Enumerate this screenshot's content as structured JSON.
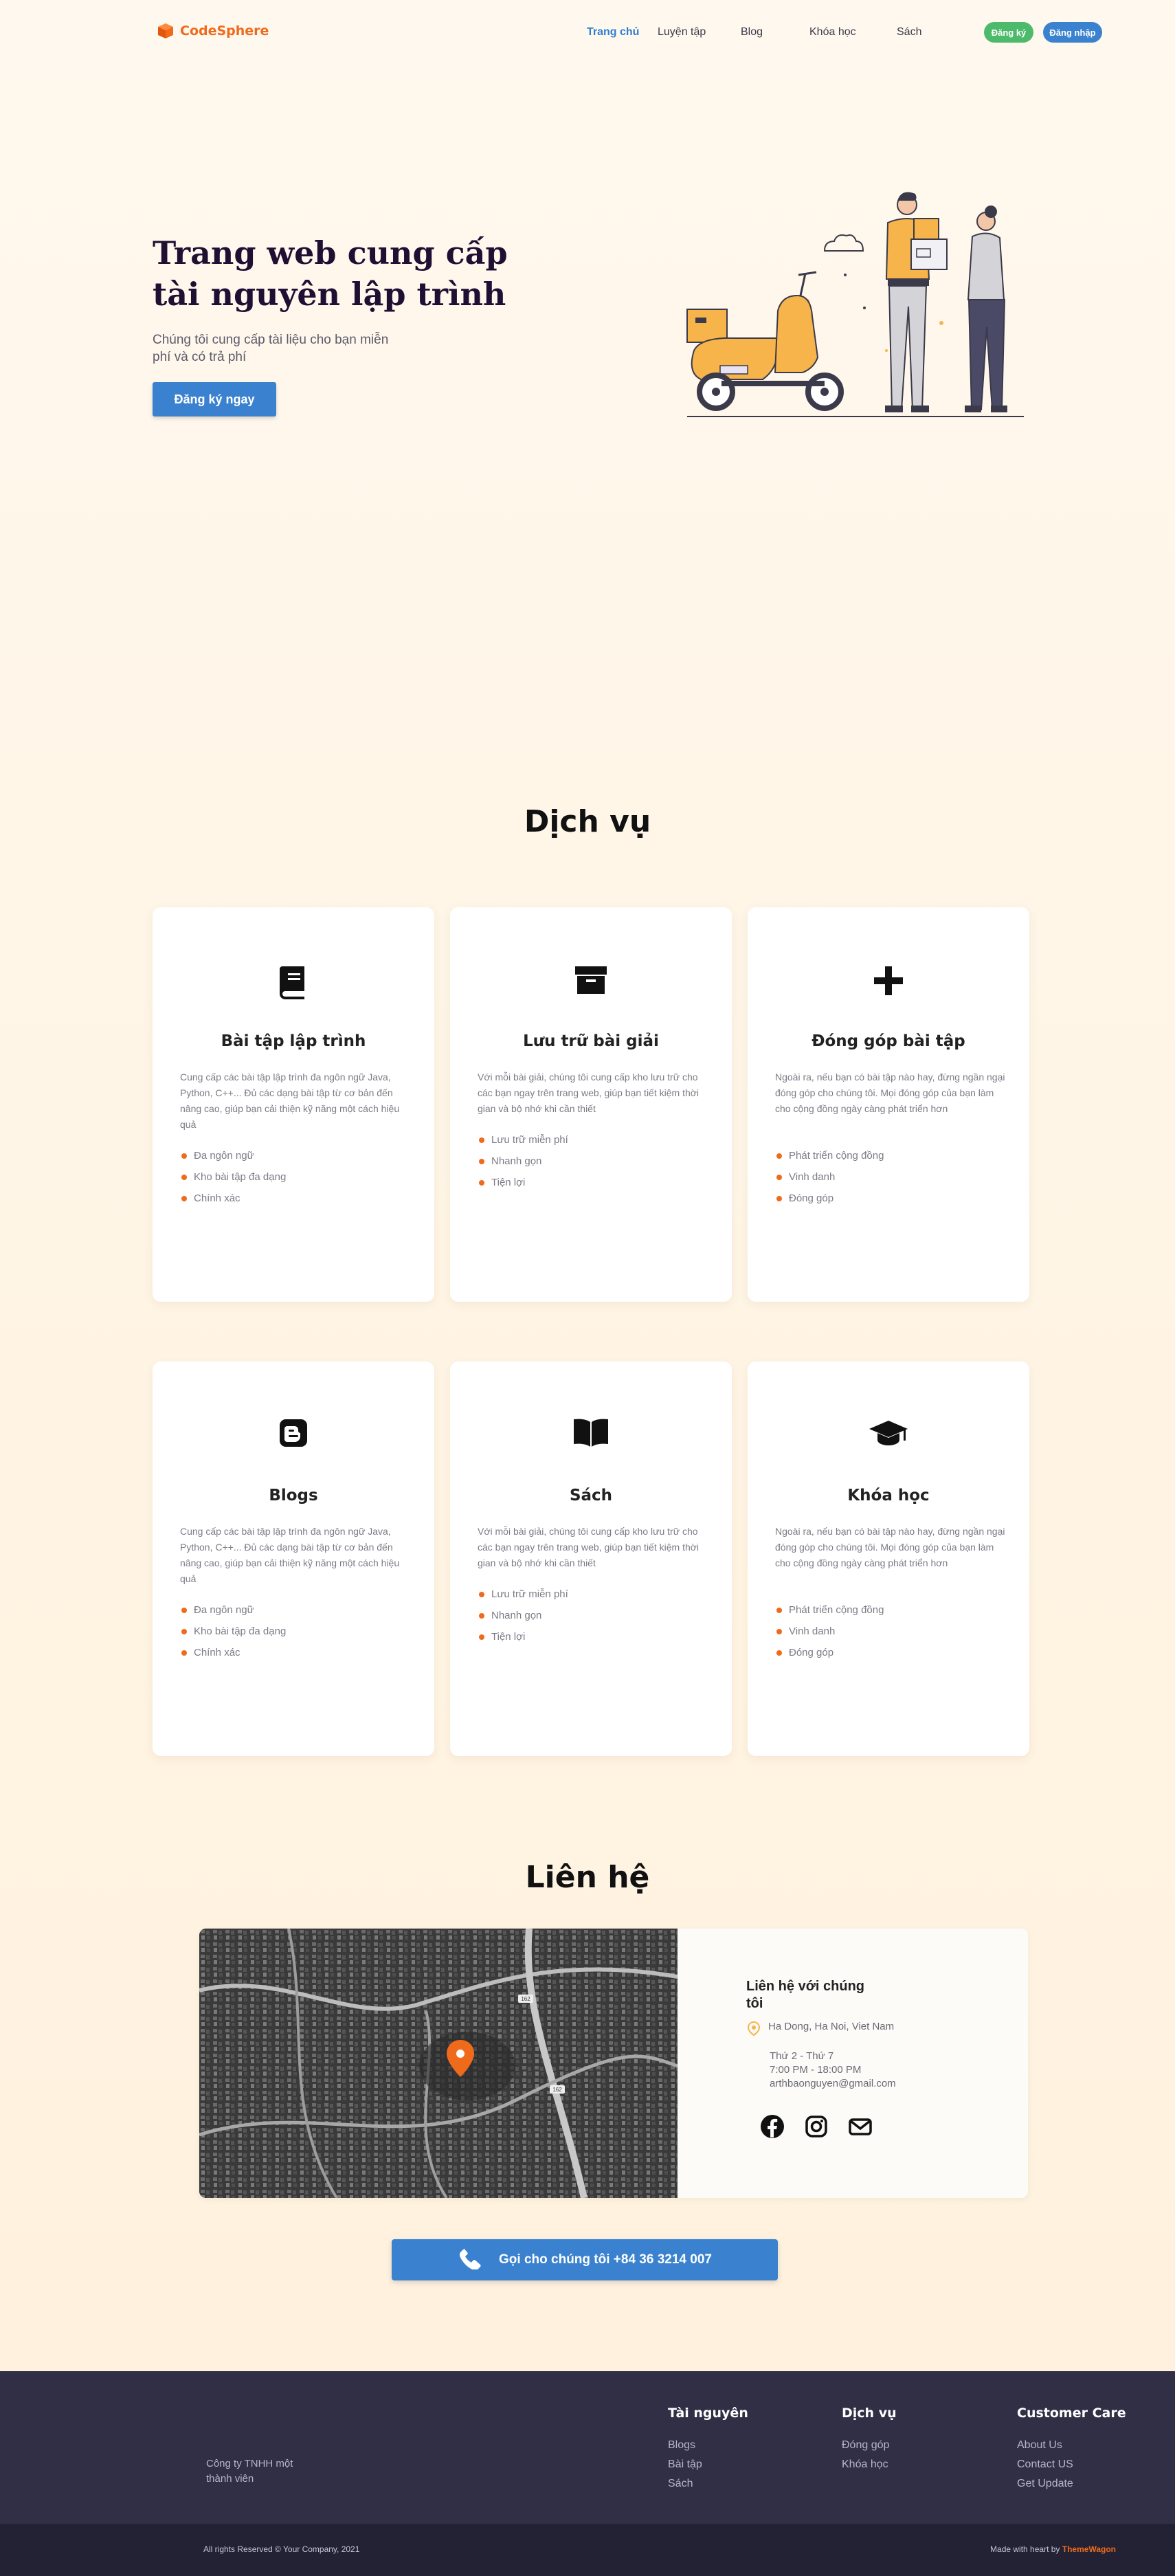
{
  "nav": {
    "brand": "CodeSphere",
    "links": [
      "Trang chủ",
      "Luyện tập",
      "Blog",
      "Khóa học",
      "Sách"
    ],
    "register": "Đăng ký",
    "login": "Đăng nhập"
  },
  "hero": {
    "title": "Trang web cung cấp tài nguyên lập trình",
    "subtitle": "Chúng tôi cung cấp tài liệu cho bạn miễn phí và có trả phí",
    "cta": "Đăng ký ngay"
  },
  "services": {
    "title": "Dịch vụ",
    "cards": [
      {
        "icon": "book-icon",
        "title": "Bài tập lập trình",
        "desc": "Cung cấp các bài tập lập trình đa ngôn ngữ Java, Python, C++... Đủ các dạng bài tập từ cơ bản đến nâng cao, giúp bạn cải thiện kỹ năng một cách hiệu quả",
        "items": [
          "Đa ngôn ngữ",
          "Kho bài tập đa dạng",
          "Chính xác"
        ]
      },
      {
        "icon": "archive-icon",
        "title": "Lưu trữ bài giải",
        "desc": "Với mỗi bài giải, chúng tôi cung cấp kho lưu trữ cho các bạn ngay trên trang web, giúp bạn tiết kiệm thời gian và bộ nhớ khi cần thiết",
        "items": [
          "Lưu trữ miễn phí",
          "Nhanh gọn",
          "Tiện lợi"
        ]
      },
      {
        "icon": "plus-icon",
        "title": "Đóng góp bài tập",
        "desc": "Ngoài ra, nếu bạn có bài tập nào hay, đừng ngần ngại đóng góp cho chúng tôi. Mọi đóng góp của bạn làm cho cộng đồng ngày càng phát triển hơn",
        "items": [
          "Phát triển cộng đồng",
          "Vinh danh",
          "Đóng góp"
        ]
      },
      {
        "icon": "blogger-icon",
        "title": "Blogs",
        "desc": "Cung cấp các bài tập lập trình đa ngôn ngữ Java, Python, C++... Đủ các dạng bài tập từ cơ bản đến nâng cao, giúp bạn cải thiện kỹ năng một cách hiệu quả",
        "items": [
          "Đa ngôn ngữ",
          "Kho bài tập đa dạng",
          "Chính xác"
        ]
      },
      {
        "icon": "open-book-icon",
        "title": "Sách",
        "desc": "Với mỗi bài giải, chúng tôi cung cấp kho lưu trữ cho các bạn ngay trên trang web, giúp bạn tiết kiệm thời gian và bộ nhớ khi cần thiết",
        "items": [
          "Lưu trữ miễn phí",
          "Nhanh gọn",
          "Tiện lợi"
        ]
      },
      {
        "icon": "graduation-cap-icon",
        "title": "Khóa học",
        "desc": "Ngoài ra, nếu bạn có bài tập nào hay, đừng ngần ngại đóng góp cho chúng tôi. Mọi đóng góp của bạn làm cho cộng đồng ngày càng phát triển hơn",
        "items": [
          "Phát triển cộng đồng",
          "Vinh danh",
          "Đóng góp"
        ]
      }
    ]
  },
  "contact": {
    "title": "Liên hệ",
    "box_title": "Liên hệ với chúng tôi",
    "address": "Ha Dong, Ha Noi, Viet Nam",
    "hours_days": "Thứ 2 - Thứ 7",
    "hours_time": "7:00 PM - 18:00 PM",
    "email": "arthbaonguyen@gmail.com",
    "map_labels": [
      "162",
      "162"
    ],
    "call_button": "Gọi cho chúng tôi +84 36 3214 007"
  },
  "footer": {
    "company": "Công ty TNHH một thành viên",
    "columns": [
      {
        "title": "Tài nguyên",
        "links": [
          "Blogs",
          "Bài tập",
          "Sách"
        ]
      },
      {
        "title": "Dịch vụ",
        "links": [
          "Đóng góp",
          "Khóa học"
        ]
      },
      {
        "title": "Customer Care",
        "links": [
          "About Us",
          "Contact US",
          "Get Update"
        ]
      }
    ],
    "copyright": "All rights Reserved © Your Company, 2021",
    "made_with": "Made with heart by",
    "made_by": "ThemeWagon"
  },
  "colors": {
    "accent": "#f06a1c",
    "primary": "#3a82cf",
    "success": "#4cba6a",
    "footer": "#302f46"
  }
}
